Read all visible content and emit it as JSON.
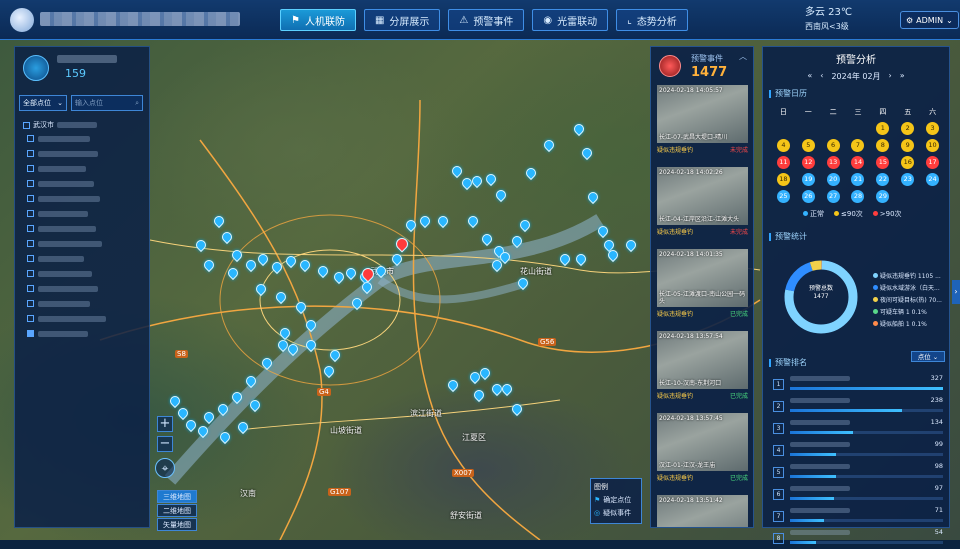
{
  "header": {
    "tabs": [
      {
        "label": "人机联防",
        "icon": "flag-icon",
        "active": true
      },
      {
        "label": "分屏展示",
        "icon": "grid-icon",
        "active": false
      },
      {
        "label": "预警事件",
        "icon": "alert-icon",
        "active": false
      },
      {
        "label": "光雷联动",
        "icon": "radar-icon",
        "active": false
      },
      {
        "label": "态势分析",
        "icon": "chart-icon",
        "active": false
      }
    ],
    "weather": {
      "temp": "多云 23℃",
      "wind": "西南风<3级"
    },
    "user": "ADMIN"
  },
  "left": {
    "count": "159",
    "filter": {
      "select": "全部点位",
      "search_placeholder": "输入点位"
    },
    "tree_root": "武汉市"
  },
  "map": {
    "places": [
      "武汉市",
      "花山街道",
      "汉南",
      "滨江街道",
      "舒安街道",
      "山坡街道",
      "江夏区"
    ],
    "roads": [
      "G4",
      "S8",
      "G56",
      "G107",
      "X007"
    ],
    "zoom_in": "+",
    "zoom_out": "−",
    "map_types": [
      "三维地图",
      "二维地图",
      "矢量地图"
    ],
    "legend": {
      "title": "图例",
      "items": [
        "确定点位",
        "疑似事件"
      ]
    }
  },
  "events": {
    "title": "预警事件",
    "count": "1477",
    "items": [
      {
        "time": "2024-02-18 14:05:57",
        "loc": "长江-07-武昌大堤口-晴川",
        "type": "疑似违规垂钓",
        "status": "未完成",
        "status_class": "st-red"
      },
      {
        "time": "2024-02-18 14:02:26",
        "loc": "长江-04-江岸区沿江-江滩大头",
        "type": "疑似违规垂钓",
        "status": "未完成",
        "status_class": "st-red"
      },
      {
        "time": "2024-02-18 14:01:35",
        "loc": "长江-05-江滩渡口-南山公园一码头",
        "type": "疑似违规垂钓",
        "status": "已完成",
        "status_class": "st-green"
      },
      {
        "time": "2024-02-18 13:57:54",
        "loc": "长江-10-汉南-东荆河口",
        "type": "疑似违规垂钓",
        "status": "已完成",
        "status_class": "st-green"
      },
      {
        "time": "2024-02-18 13:57:45",
        "loc": "汉江-01-江汉-龙王庙",
        "type": "疑似违规垂钓",
        "status": "已完成",
        "status_class": "st-green"
      },
      {
        "time": "2024-02-18 13:51:42",
        "loc": "",
        "type": "",
        "status": "",
        "status_class": "st-green"
      }
    ]
  },
  "analysis": {
    "title": "预警分析",
    "month": "2024年 02月",
    "nav": {
      "first": "«",
      "prev": "‹",
      "next": "›",
      "last": "»"
    },
    "calendar_title": "预警日历",
    "weekdays": [
      "日",
      "一",
      "二",
      "三",
      "四",
      "五",
      "六"
    ],
    "days": [
      {
        "d": "",
        "level": "none"
      },
      {
        "d": "",
        "level": "none"
      },
      {
        "d": "",
        "level": "none"
      },
      {
        "d": "",
        "level": "none"
      },
      {
        "d": "1",
        "level": "mid"
      },
      {
        "d": "2",
        "level": "mid"
      },
      {
        "d": "3",
        "level": "mid"
      },
      {
        "d": "4",
        "level": "mid"
      },
      {
        "d": "5",
        "level": "mid"
      },
      {
        "d": "6",
        "level": "mid"
      },
      {
        "d": "7",
        "level": "mid"
      },
      {
        "d": "8",
        "level": "mid"
      },
      {
        "d": "9",
        "level": "mid"
      },
      {
        "d": "10",
        "level": "mid"
      },
      {
        "d": "11",
        "level": "high"
      },
      {
        "d": "12",
        "level": "high"
      },
      {
        "d": "13",
        "level": "high"
      },
      {
        "d": "14",
        "level": "high"
      },
      {
        "d": "15",
        "level": "high"
      },
      {
        "d": "16",
        "level": "mid"
      },
      {
        "d": "17",
        "level": "high"
      },
      {
        "d": "18",
        "level": "mid"
      },
      {
        "d": "19",
        "level": "normal"
      },
      {
        "d": "20",
        "level": "normal"
      },
      {
        "d": "21",
        "level": "normal"
      },
      {
        "d": "22",
        "level": "normal"
      },
      {
        "d": "23",
        "level": "normal"
      },
      {
        "d": "24",
        "level": "normal"
      },
      {
        "d": "25",
        "level": "normal"
      },
      {
        "d": "26",
        "level": "normal"
      },
      {
        "d": "27",
        "level": "normal"
      },
      {
        "d": "28",
        "level": "normal"
      },
      {
        "d": "29",
        "level": "normal"
      }
    ],
    "cal_legend": [
      "正常",
      "≤90次",
      ">90次"
    ],
    "stats_title": "预警统计",
    "donut_label": "预警总数",
    "donut_total": "1477",
    "stats": [
      {
        "label": "疑似违规垂钓  1105 ...",
        "value": 1105,
        "color": "#7fd3ff"
      },
      {
        "label": "疑似水域游泳（白天...",
        "value": 236,
        "color": "#2f8dff"
      },
      {
        "label": "夜间可疑目标(热)  70...",
        "value": 70,
        "color": "#f2d14b"
      },
      {
        "label": "可疑车辆  1  0.1%",
        "value": 1,
        "color": "#59d88a"
      },
      {
        "label": "疑似船舶  1  0.1%",
        "value": 1,
        "color": "#ff8a4a"
      }
    ],
    "rank_title": "预警排名",
    "rank_select": "点位",
    "ranks": [
      {
        "no": "1",
        "value": "327",
        "ratio": 1.0
      },
      {
        "no": "2",
        "value": "238",
        "ratio": 0.73
      },
      {
        "no": "3",
        "value": "134",
        "ratio": 0.41
      },
      {
        "no": "4",
        "value": "99",
        "ratio": 0.3
      },
      {
        "no": "5",
        "value": "98",
        "ratio": 0.3
      },
      {
        "no": "6",
        "value": "97",
        "ratio": 0.29
      },
      {
        "no": "7",
        "value": "71",
        "ratio": 0.22
      },
      {
        "no": "8",
        "value": "54",
        "ratio": 0.17
      }
    ]
  }
}
